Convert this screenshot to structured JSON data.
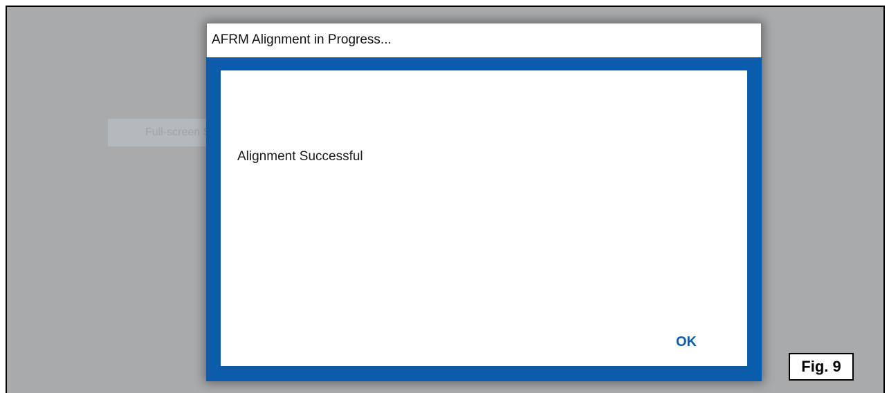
{
  "background": {
    "ghost_tooltip": "Full-screen Snip"
  },
  "dialog": {
    "title": "AFRM Alignment in Progress...",
    "message": "Alignment Successful",
    "ok_label": "OK"
  },
  "figure": {
    "label": "Fig. 9"
  },
  "colors": {
    "accent_blue": "#0b5dab",
    "desktop_gray": "#a9aaac"
  }
}
